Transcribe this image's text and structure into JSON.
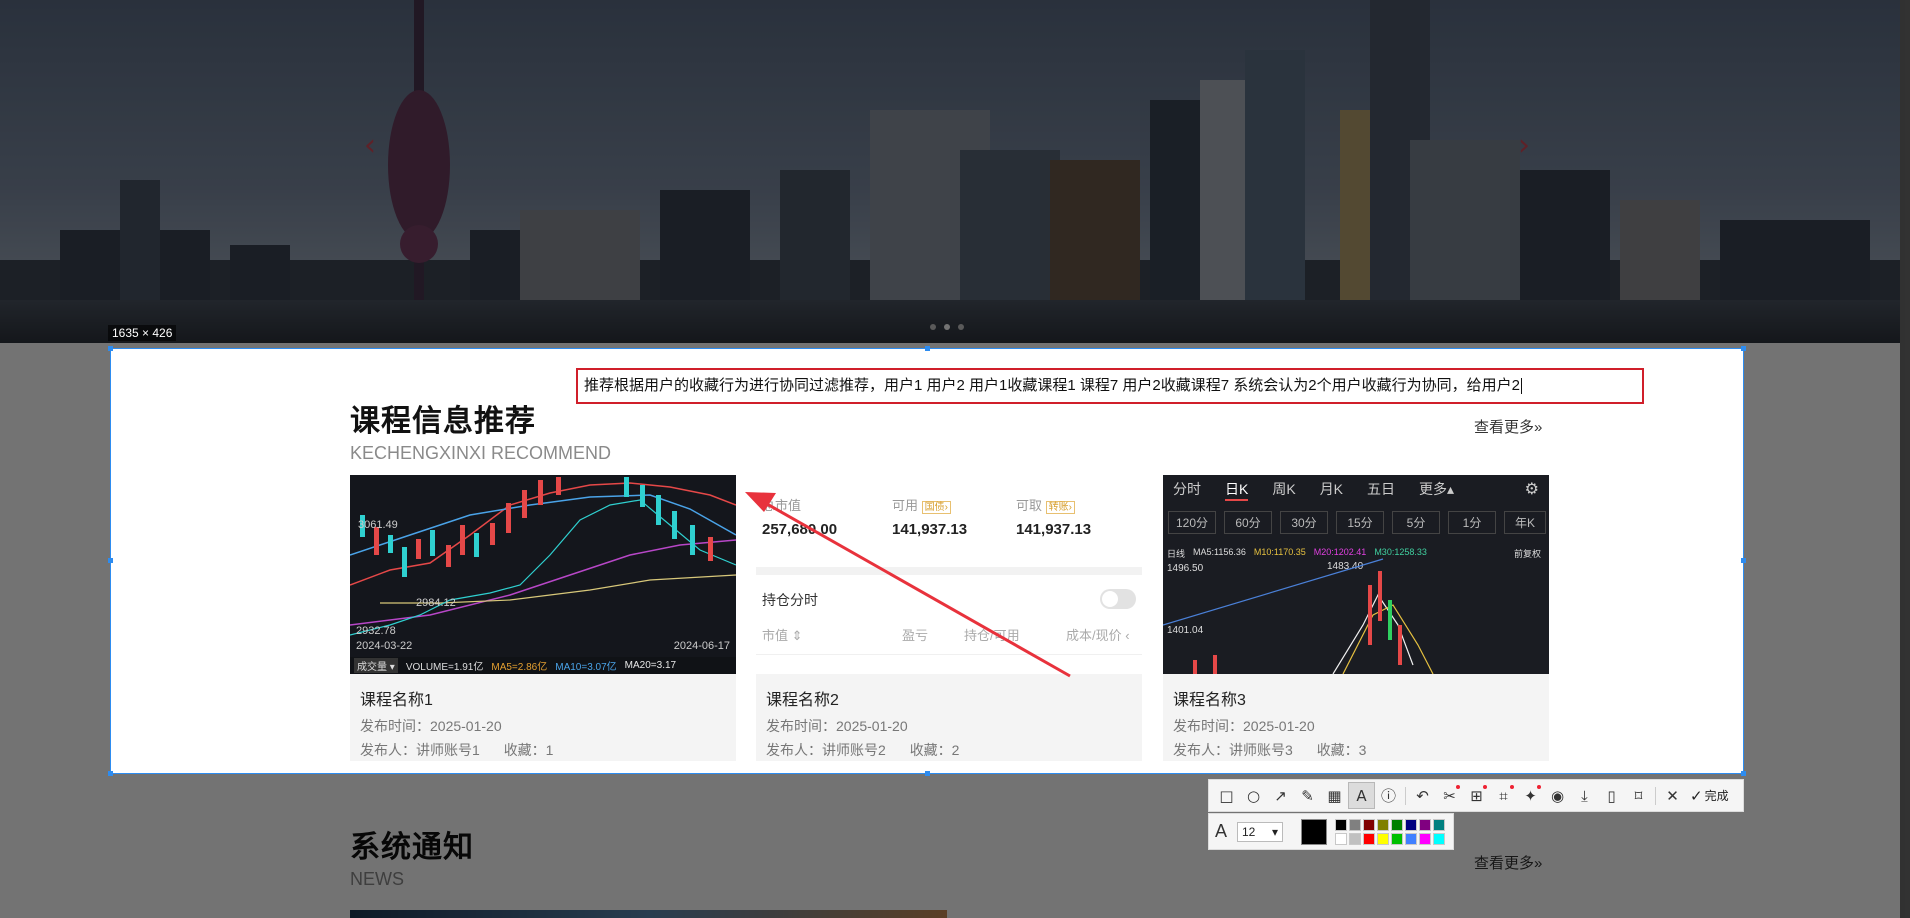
{
  "hero": {
    "prev": "‹",
    "next": "›"
  },
  "capture": {
    "size_label": "1635 × 426"
  },
  "annotation_text": "推荐根据用户的收藏行为进行协同过滤推荐，用户1 用户2 用户1收藏课程1 课程7 用户2收藏课程7 系统会认为2个用户收藏行为协同，给用户2",
  "recommend": {
    "title": "课程信息推荐",
    "subtitle": "KECHENGXINXI RECOMMEND",
    "more": "查看更多»",
    "cards": [
      {
        "name": "课程名称1",
        "time": "发布时间：2025-01-20",
        "publisher": "发布人：讲师账号1",
        "fav": "收藏：1"
      },
      {
        "name": "课程名称2",
        "time": "发布时间：2025-01-20",
        "publisher": "发布人：讲师账号2",
        "fav": "收藏：2"
      },
      {
        "name": "课程名称3",
        "time": "发布时间：2025-01-20",
        "publisher": "发布人：讲师账号3",
        "fav": "收藏：3"
      }
    ]
  },
  "thumb1": {
    "p1": "3061.49",
    "p2": "2984.12",
    "p3": "2932.78",
    "date_start": "2024-03-22",
    "date_end": "2024-06-17",
    "ind_sel": "成交量 ▾",
    "vol": "VOLUME=1.91亿",
    "ma5": "MA5=2.86亿",
    "ma10": "MA10=3.07亿",
    "ma20": "MA20=3.17"
  },
  "thumb2": {
    "h1": "总市值",
    "h2": "可用",
    "h3": "可取",
    "b2": "国债›",
    "b3": "转账›",
    "v1": "257,680.00",
    "v2": "141,937.13",
    "v3": "141,937.13",
    "pos": "持仓分时",
    "c1": "市值 ⇕",
    "c2": "盈亏",
    "c3": "持仓/可用",
    "c4": "成本/现价 ‹"
  },
  "thumb3": {
    "tabs": [
      "分时",
      "日K",
      "周K",
      "月K",
      "五日",
      "更多▴"
    ],
    "periods": [
      "120分",
      "60分",
      "30分",
      "15分",
      "5分",
      "1分",
      "年K"
    ],
    "l_day": "日线",
    "ma5": "MA5:1156.36",
    "ma10": "M10:1170.35",
    "ma20": "M20:1202.41",
    "ma30": "M30:1258.33",
    "adj": "前复权",
    "top": "1496.50",
    "peak": "1483.40",
    "low": "1401.04"
  },
  "news": {
    "title": "系统通知",
    "subtitle": "NEWS",
    "more": "查看更多»"
  },
  "toolbar": {
    "done": "完成"
  },
  "text_tool": {
    "size": "12"
  },
  "palette": [
    "#000000",
    "#808080",
    "#800000",
    "#808000",
    "#008000",
    "#000080",
    "#800080",
    "#008080",
    "#ffffff",
    "#c0c0c0",
    "#ff0000",
    "#ffff00",
    "#00c000",
    "#4080ff",
    "#ff00ff",
    "#00ffff"
  ]
}
